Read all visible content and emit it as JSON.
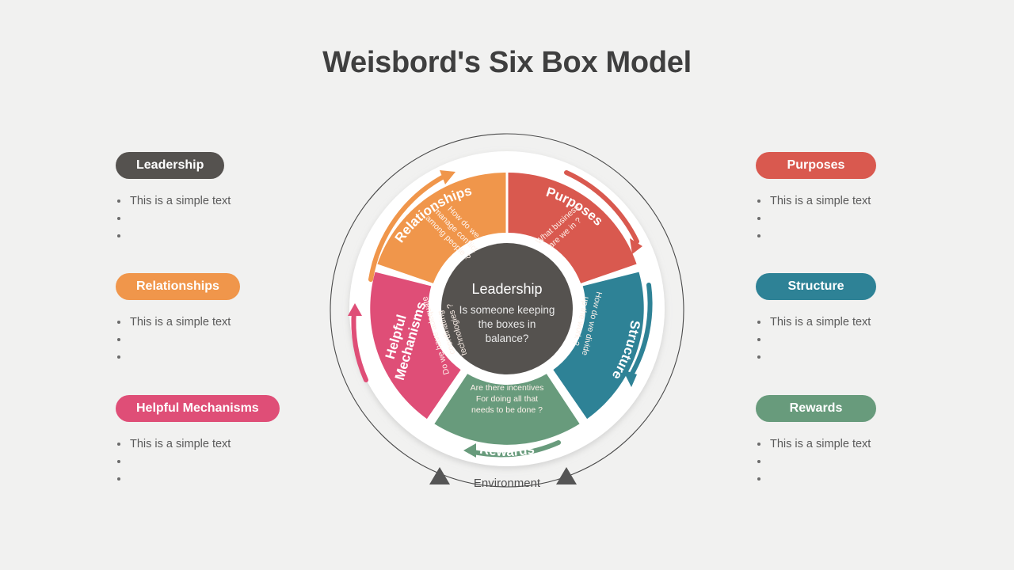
{
  "header": {
    "title": "Weisbord's Six Box Model"
  },
  "colors": {
    "background": "#f1f1f0",
    "title": "#3f3f3f",
    "leadership": "#55524f",
    "relationships": "#f0964b",
    "purposes": "#d9594f",
    "structure": "#2e8296",
    "rewards": "#689b7c",
    "helpful_mechanisms": "#df4e77",
    "wheel_ring": "#ffffff",
    "environment_line": "#4a4a4a"
  },
  "side_panels": {
    "left": [
      {
        "id": "leadership",
        "label": "Leadership",
        "color": "#55524f",
        "bullets": [
          "This is a simple text",
          "",
          ""
        ]
      },
      {
        "id": "relationships",
        "label": "Relationships",
        "color": "#f0964b",
        "bullets": [
          "This is a simple text",
          "",
          ""
        ]
      },
      {
        "id": "helpful-mechanisms",
        "label": "Helpful Mechanisms",
        "color": "#df4e77",
        "bullets": [
          "This is a simple text",
          "",
          ""
        ]
      }
    ],
    "right": [
      {
        "id": "purposes",
        "label": "Purposes",
        "color": "#d9594f",
        "bullets": [
          "This is a simple text",
          "",
          ""
        ]
      },
      {
        "id": "structure",
        "label": "Structure",
        "color": "#2e8296",
        "bullets": [
          "This is a simple text",
          "",
          ""
        ]
      },
      {
        "id": "rewards",
        "label": "Rewards",
        "color": "#689b7c",
        "bullets": [
          "This is a simple text",
          "",
          ""
        ]
      }
    ]
  },
  "wheel": {
    "center": {
      "title": "Leadership",
      "question_lines": [
        "Is someone keeping",
        "the boxes in",
        "balance?"
      ]
    },
    "segments": {
      "relationships": {
        "label": "Relationships",
        "question_lines": [
          "How do we",
          "manage conflict",
          "among people  ?"
        ]
      },
      "purposes": {
        "label": "Purposes",
        "question_lines": [
          "What business",
          "are we in ?"
        ]
      },
      "structure": {
        "label": "Structure",
        "question_lines": [
          "How do we divide",
          "up the work ?"
        ]
      },
      "rewards": {
        "label": "Rewards",
        "question_lines": [
          "Are there  incentives",
          "For  doing  all that",
          "needs  to  be done  ?"
        ]
      },
      "helpful_mechanisms": {
        "label_lines": [
          "Helpful",
          "Mechanisms"
        ],
        "question_lines": [
          "Do we have adequate",
          "coordinating",
          "technologies  ?"
        ]
      }
    },
    "environment_label": "Environment"
  }
}
